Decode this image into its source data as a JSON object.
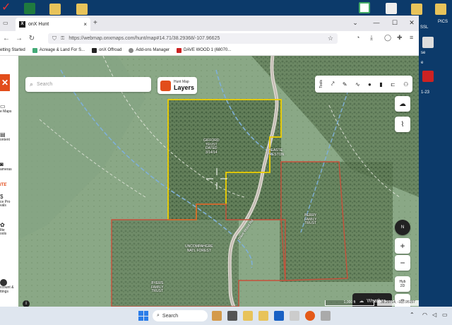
{
  "desktop": {
    "right_labels": [
      "PICS",
      "SSL",
      "se",
      "e",
      "1-23"
    ]
  },
  "browser": {
    "tab_title": "onX Hunt",
    "new_tab": "+",
    "url": "https://webmap.onxmaps.com/hunt/map#14.71/38.29368/-107.96625",
    "bookmarks": [
      {
        "label": "etting Started",
        "color": "#e66000"
      },
      {
        "label": "Acreage & Land For S...",
        "color": "#4a7"
      },
      {
        "label": "onX Offroad",
        "color": "#222"
      },
      {
        "label": "Add-ons Manager",
        "color": "#666"
      },
      {
        "label": "DAVE WOOD 1 (68070...",
        "color": "#c22"
      }
    ]
  },
  "app": {
    "left_rail": [
      {
        "label": "e Maps"
      },
      {
        "label": "ontent"
      },
      {
        "label": "ameras"
      },
      {
        "label": "ITE"
      },
      {
        "label": "ce Pro\nvals"
      },
      {
        "label": "Ilte\nools"
      },
      {
        "label": "ccount &\nttings"
      }
    ],
    "search_placeholder": "Search",
    "layers_sub": "Hunt Map",
    "layers_label": "Layers",
    "toolbar_label": "Tools",
    "weather_label": "Weather",
    "compass_label": "N",
    "hyb_label": "Hyb",
    "twod_label": "2D",
    "mapbox_label": "mapbox",
    "scale_label": "1,000 ft",
    "coords_label": "38.29714, -107.95157",
    "parcels": [
      {
        "name": "GIFFORD\nTRUST\nDATED\n3/14/14"
      },
      {
        "name": "HEASTE\nPRESTON"
      },
      {
        "name": "BERRY\nFAMILY\nTRUST"
      },
      {
        "name": "UNCOMPAHGRE\nNATL FOREST"
      },
      {
        "name": "BYERS\nFAMILY\nTRUST"
      }
    ],
    "road_label": "Dave Wood Rd"
  },
  "taskbar": {
    "search_text": "Search"
  },
  "colors": {
    "brand": "#e24d1b",
    "boundary_yellow": "#f0d000",
    "boundary_red": "#c8503a"
  }
}
